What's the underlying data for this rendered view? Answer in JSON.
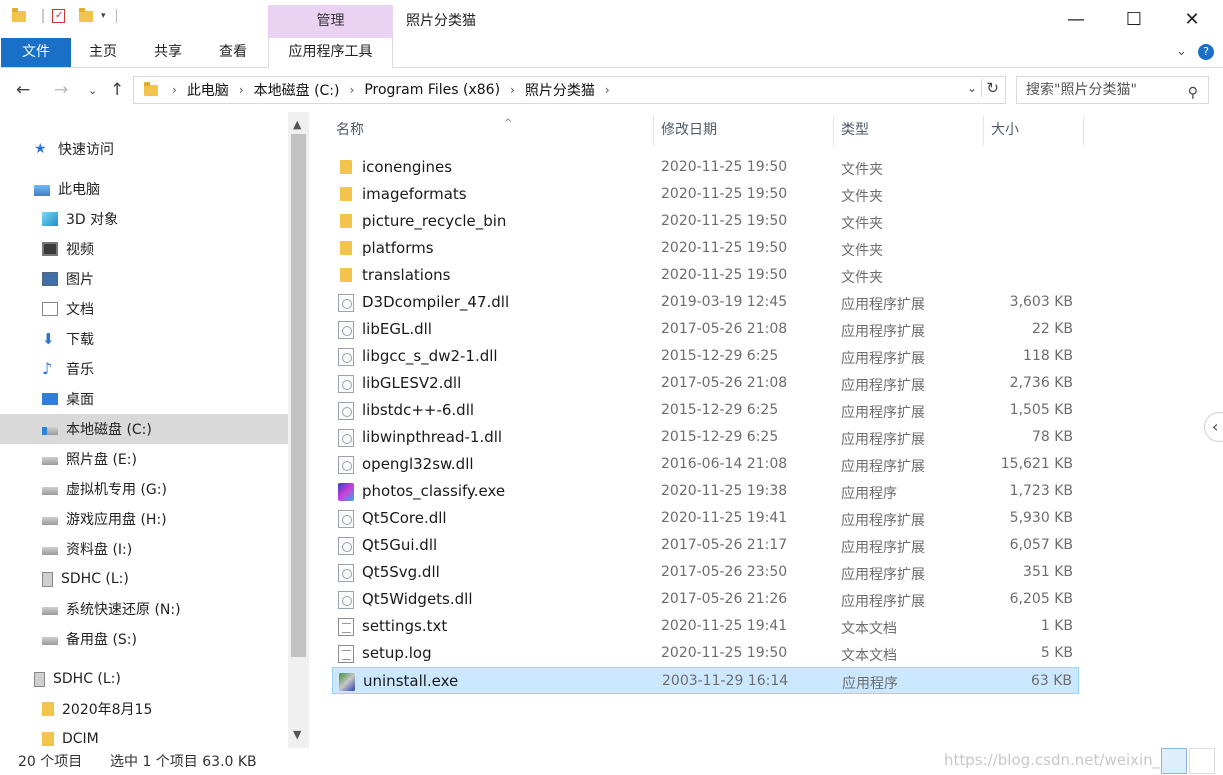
{
  "titlebar": {
    "quick_access": [
      "folder-icon",
      "properties-icon",
      "new-folder-icon",
      "customize-icon"
    ],
    "context_tab": "管理",
    "title": "照片分类猫",
    "buttons": [
      "—",
      "☐",
      "✕"
    ]
  },
  "ribbon": {
    "tabs": [
      "文件",
      "主页",
      "共享",
      "查看"
    ],
    "context_tab": "应用程序工具",
    "collapse_icon": "⌄",
    "help_icon": "?"
  },
  "address": {
    "crumbs": [
      "此电脑",
      "本地磁盘 (C:)",
      "Program Files (x86)",
      "照片分类猫"
    ],
    "search_placeholder": "搜索\"照片分类猫\""
  },
  "nav": {
    "items": [
      {
        "label": "快速访问",
        "icon": "star-icon"
      },
      {
        "label": "此电脑",
        "icon": "computer-icon"
      },
      {
        "label": "3D 对象",
        "icon": "cube-icon"
      },
      {
        "label": "视频",
        "icon": "film-icon"
      },
      {
        "label": "图片",
        "icon": "picture-icon"
      },
      {
        "label": "文档",
        "icon": "document-icon"
      },
      {
        "label": "下载",
        "icon": "download-icon"
      },
      {
        "label": "音乐",
        "icon": "music-icon"
      },
      {
        "label": "桌面",
        "icon": "desktop-icon"
      },
      {
        "label": "本地磁盘 (C:)",
        "icon": "system-drive-icon"
      },
      {
        "label": "照片盘 (E:)",
        "icon": "drive-icon"
      },
      {
        "label": "虚拟机专用 (G:)",
        "icon": "drive-icon"
      },
      {
        "label": "游戏应用盘 (H:)",
        "icon": "drive-icon"
      },
      {
        "label": "资料盘 (I:)",
        "icon": "drive-icon"
      },
      {
        "label": "SDHC (L:)",
        "icon": "sd-card-icon"
      },
      {
        "label": "系统快速还原 (N:)",
        "icon": "drive-icon"
      },
      {
        "label": "备用盘 (S:)",
        "icon": "drive-icon"
      },
      {
        "label": "SDHC (L:)",
        "icon": "sd-card-icon"
      },
      {
        "label": "2020年8月15",
        "icon": "folder-icon"
      },
      {
        "label": "DCIM",
        "icon": "folder-icon"
      }
    ]
  },
  "columns": {
    "name": "名称",
    "date": "修改日期",
    "type": "类型",
    "size": "大小"
  },
  "files": [
    {
      "name": "iconengines",
      "date": "2020-11-25 19:50",
      "type": "文件夹",
      "size": "",
      "icon": "folder"
    },
    {
      "name": "imageformats",
      "date": "2020-11-25 19:50",
      "type": "文件夹",
      "size": "",
      "icon": "folder"
    },
    {
      "name": "picture_recycle_bin",
      "date": "2020-11-25 19:50",
      "type": "文件夹",
      "size": "",
      "icon": "folder"
    },
    {
      "name": "platforms",
      "date": "2020-11-25 19:50",
      "type": "文件夹",
      "size": "",
      "icon": "folder"
    },
    {
      "name": "translations",
      "date": "2020-11-25 19:50",
      "type": "文件夹",
      "size": "",
      "icon": "folder"
    },
    {
      "name": "D3Dcompiler_47.dll",
      "date": "2019-03-19 12:45",
      "type": "应用程序扩展",
      "size": "3,603 KB",
      "icon": "dll"
    },
    {
      "name": "libEGL.dll",
      "date": "2017-05-26 21:08",
      "type": "应用程序扩展",
      "size": "22 KB",
      "icon": "dll"
    },
    {
      "name": "libgcc_s_dw2-1.dll",
      "date": "2015-12-29 6:25",
      "type": "应用程序扩展",
      "size": "118 KB",
      "icon": "dll"
    },
    {
      "name": "libGLESV2.dll",
      "date": "2017-05-26 21:08",
      "type": "应用程序扩展",
      "size": "2,736 KB",
      "icon": "dll"
    },
    {
      "name": "libstdc++-6.dll",
      "date": "2015-12-29 6:25",
      "type": "应用程序扩展",
      "size": "1,505 KB",
      "icon": "dll"
    },
    {
      "name": "libwinpthread-1.dll",
      "date": "2015-12-29 6:25",
      "type": "应用程序扩展",
      "size": "78 KB",
      "icon": "dll"
    },
    {
      "name": "opengl32sw.dll",
      "date": "2016-06-14 21:08",
      "type": "应用程序扩展",
      "size": "15,621 KB",
      "icon": "dll"
    },
    {
      "name": "photos_classify.exe",
      "date": "2020-11-25 19:38",
      "type": "应用程序",
      "size": "1,723 KB",
      "icon": "exe"
    },
    {
      "name": "Qt5Core.dll",
      "date": "2020-11-25 19:41",
      "type": "应用程序扩展",
      "size": "5,930 KB",
      "icon": "dll"
    },
    {
      "name": "Qt5Gui.dll",
      "date": "2017-05-26 21:17",
      "type": "应用程序扩展",
      "size": "6,057 KB",
      "icon": "dll"
    },
    {
      "name": "Qt5Svg.dll",
      "date": "2017-05-26 23:50",
      "type": "应用程序扩展",
      "size": "351 KB",
      "icon": "dll"
    },
    {
      "name": "Qt5Widgets.dll",
      "date": "2017-05-26 21:26",
      "type": "应用程序扩展",
      "size": "6,205 KB",
      "icon": "dll"
    },
    {
      "name": "settings.txt",
      "date": "2020-11-25 19:41",
      "type": "文本文档",
      "size": "1 KB",
      "icon": "txt"
    },
    {
      "name": "setup.log",
      "date": "2020-11-25 19:50",
      "type": "文本文档",
      "size": "5 KB",
      "icon": "txt"
    },
    {
      "name": "uninstall.exe",
      "date": "2003-11-29 16:14",
      "type": "应用程序",
      "size": "63 KB",
      "icon": "uninstall"
    }
  ],
  "selected_index": 19,
  "status": {
    "count": "20 个项目",
    "selection": "选中 1 个项目  63.0 KB",
    "watermark": "https://blog.csdn.net/weixin_44"
  },
  "colors": {
    "accent": "#1a6fc6",
    "context_tab": "#ebd2f3",
    "selection": "#cce8ff"
  }
}
